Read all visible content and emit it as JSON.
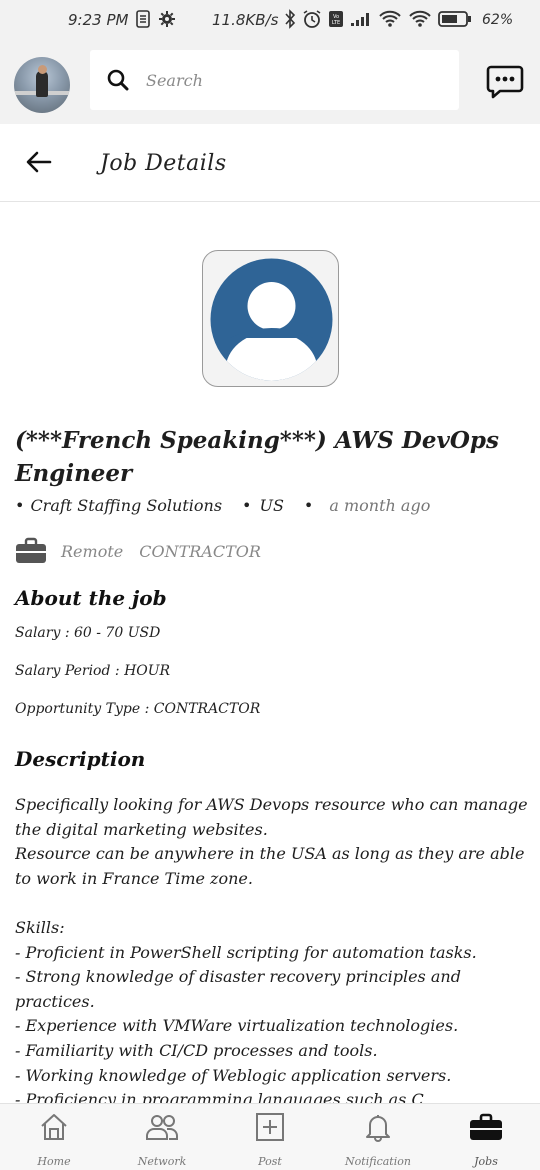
{
  "status_bar": {
    "time": "9:23 PM",
    "network_speed": "11.8KB/s",
    "battery": "62%"
  },
  "top_bar": {
    "search_placeholder": "Search"
  },
  "header": {
    "title": "Job Details"
  },
  "job": {
    "title": "(***French Speaking***) AWS DevOps Engineer",
    "company": "Craft Staffing Solutions",
    "location": "US",
    "posted": "a month ago",
    "workplace": "Remote",
    "employment_type": "CONTRACTOR"
  },
  "about": {
    "heading": "About the job",
    "salary": "Salary : 60 - 70 USD",
    "salary_period": "Salary Period : HOUR",
    "opportunity_type": "Opportunity Type : CONTRACTOR"
  },
  "description": {
    "heading": "Description",
    "body": "Specifically looking for AWS Devops resource who can manage the digital marketing websites.\nResource can be anywhere in the USA as long as they are able to work in France Time zone.\n\nSkills:\n- Proficient in PowerShell scripting for automation tasks.\n- Strong knowledge of disaster recovery principles and practices.\n- Experience with VMWare virtualization technologies.\n- Familiarity with CI/CD processes and tools.\n- Working knowledge of Weblogic application servers.\n- Proficiency in programming languages such as C"
  },
  "bottom_nav": {
    "items": [
      {
        "label": "Home",
        "icon": "home-icon"
      },
      {
        "label": "Network",
        "icon": "network-icon"
      },
      {
        "label": "Post",
        "icon": "post-icon"
      },
      {
        "label": "Notification",
        "icon": "bell-icon"
      },
      {
        "label": "Jobs",
        "icon": "briefcase-icon"
      }
    ],
    "active": "Jobs"
  },
  "colors": {
    "logo_blue": "#2f6496",
    "background_gray": "#f2f2f2"
  }
}
